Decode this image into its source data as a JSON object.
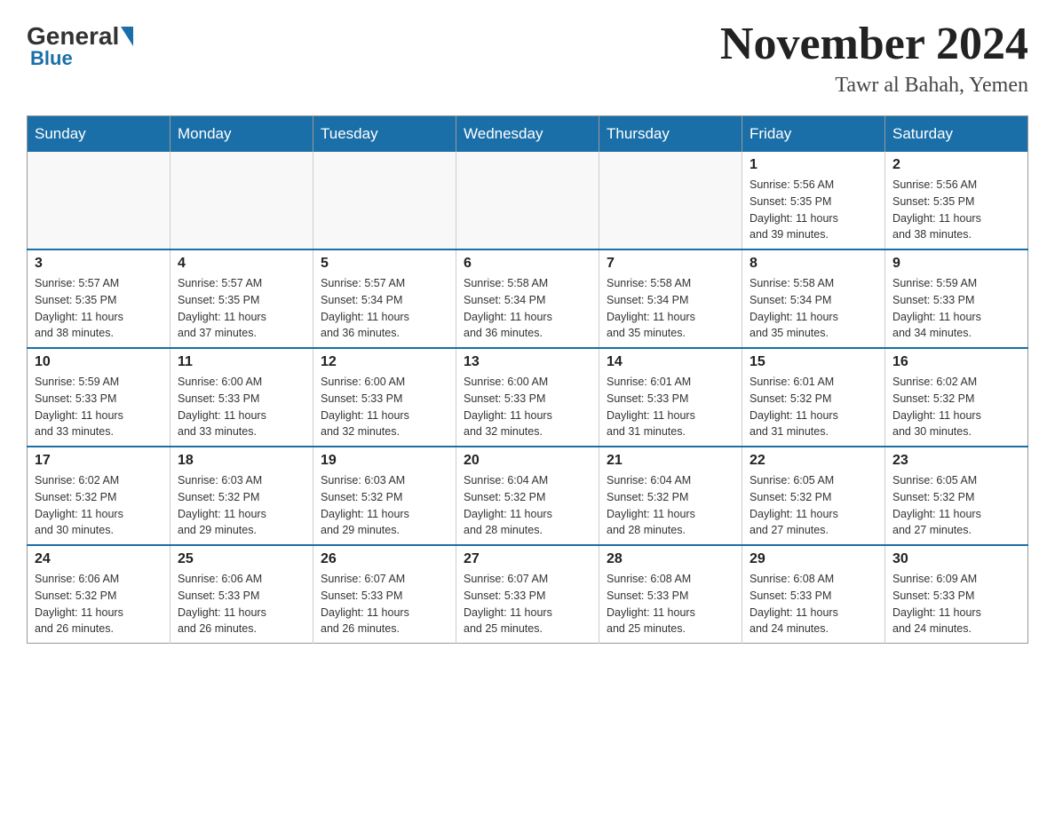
{
  "header": {
    "logo_general": "General",
    "logo_blue": "Blue",
    "month_title": "November 2024",
    "location": "Tawr al Bahah, Yemen"
  },
  "weekdays": [
    "Sunday",
    "Monday",
    "Tuesday",
    "Wednesday",
    "Thursday",
    "Friday",
    "Saturday"
  ],
  "weeks": [
    [
      {
        "day": "",
        "info": ""
      },
      {
        "day": "",
        "info": ""
      },
      {
        "day": "",
        "info": ""
      },
      {
        "day": "",
        "info": ""
      },
      {
        "day": "",
        "info": ""
      },
      {
        "day": "1",
        "info": "Sunrise: 5:56 AM\nSunset: 5:35 PM\nDaylight: 11 hours\nand 39 minutes."
      },
      {
        "day": "2",
        "info": "Sunrise: 5:56 AM\nSunset: 5:35 PM\nDaylight: 11 hours\nand 38 minutes."
      }
    ],
    [
      {
        "day": "3",
        "info": "Sunrise: 5:57 AM\nSunset: 5:35 PM\nDaylight: 11 hours\nand 38 minutes."
      },
      {
        "day": "4",
        "info": "Sunrise: 5:57 AM\nSunset: 5:35 PM\nDaylight: 11 hours\nand 37 minutes."
      },
      {
        "day": "5",
        "info": "Sunrise: 5:57 AM\nSunset: 5:34 PM\nDaylight: 11 hours\nand 36 minutes."
      },
      {
        "day": "6",
        "info": "Sunrise: 5:58 AM\nSunset: 5:34 PM\nDaylight: 11 hours\nand 36 minutes."
      },
      {
        "day": "7",
        "info": "Sunrise: 5:58 AM\nSunset: 5:34 PM\nDaylight: 11 hours\nand 35 minutes."
      },
      {
        "day": "8",
        "info": "Sunrise: 5:58 AM\nSunset: 5:34 PM\nDaylight: 11 hours\nand 35 minutes."
      },
      {
        "day": "9",
        "info": "Sunrise: 5:59 AM\nSunset: 5:33 PM\nDaylight: 11 hours\nand 34 minutes."
      }
    ],
    [
      {
        "day": "10",
        "info": "Sunrise: 5:59 AM\nSunset: 5:33 PM\nDaylight: 11 hours\nand 33 minutes."
      },
      {
        "day": "11",
        "info": "Sunrise: 6:00 AM\nSunset: 5:33 PM\nDaylight: 11 hours\nand 33 minutes."
      },
      {
        "day": "12",
        "info": "Sunrise: 6:00 AM\nSunset: 5:33 PM\nDaylight: 11 hours\nand 32 minutes."
      },
      {
        "day": "13",
        "info": "Sunrise: 6:00 AM\nSunset: 5:33 PM\nDaylight: 11 hours\nand 32 minutes."
      },
      {
        "day": "14",
        "info": "Sunrise: 6:01 AM\nSunset: 5:33 PM\nDaylight: 11 hours\nand 31 minutes."
      },
      {
        "day": "15",
        "info": "Sunrise: 6:01 AM\nSunset: 5:32 PM\nDaylight: 11 hours\nand 31 minutes."
      },
      {
        "day": "16",
        "info": "Sunrise: 6:02 AM\nSunset: 5:32 PM\nDaylight: 11 hours\nand 30 minutes."
      }
    ],
    [
      {
        "day": "17",
        "info": "Sunrise: 6:02 AM\nSunset: 5:32 PM\nDaylight: 11 hours\nand 30 minutes."
      },
      {
        "day": "18",
        "info": "Sunrise: 6:03 AM\nSunset: 5:32 PM\nDaylight: 11 hours\nand 29 minutes."
      },
      {
        "day": "19",
        "info": "Sunrise: 6:03 AM\nSunset: 5:32 PM\nDaylight: 11 hours\nand 29 minutes."
      },
      {
        "day": "20",
        "info": "Sunrise: 6:04 AM\nSunset: 5:32 PM\nDaylight: 11 hours\nand 28 minutes."
      },
      {
        "day": "21",
        "info": "Sunrise: 6:04 AM\nSunset: 5:32 PM\nDaylight: 11 hours\nand 28 minutes."
      },
      {
        "day": "22",
        "info": "Sunrise: 6:05 AM\nSunset: 5:32 PM\nDaylight: 11 hours\nand 27 minutes."
      },
      {
        "day": "23",
        "info": "Sunrise: 6:05 AM\nSunset: 5:32 PM\nDaylight: 11 hours\nand 27 minutes."
      }
    ],
    [
      {
        "day": "24",
        "info": "Sunrise: 6:06 AM\nSunset: 5:32 PM\nDaylight: 11 hours\nand 26 minutes."
      },
      {
        "day": "25",
        "info": "Sunrise: 6:06 AM\nSunset: 5:33 PM\nDaylight: 11 hours\nand 26 minutes."
      },
      {
        "day": "26",
        "info": "Sunrise: 6:07 AM\nSunset: 5:33 PM\nDaylight: 11 hours\nand 26 minutes."
      },
      {
        "day": "27",
        "info": "Sunrise: 6:07 AM\nSunset: 5:33 PM\nDaylight: 11 hours\nand 25 minutes."
      },
      {
        "day": "28",
        "info": "Sunrise: 6:08 AM\nSunset: 5:33 PM\nDaylight: 11 hours\nand 25 minutes."
      },
      {
        "day": "29",
        "info": "Sunrise: 6:08 AM\nSunset: 5:33 PM\nDaylight: 11 hours\nand 24 minutes."
      },
      {
        "day": "30",
        "info": "Sunrise: 6:09 AM\nSunset: 5:33 PM\nDaylight: 11 hours\nand 24 minutes."
      }
    ]
  ]
}
